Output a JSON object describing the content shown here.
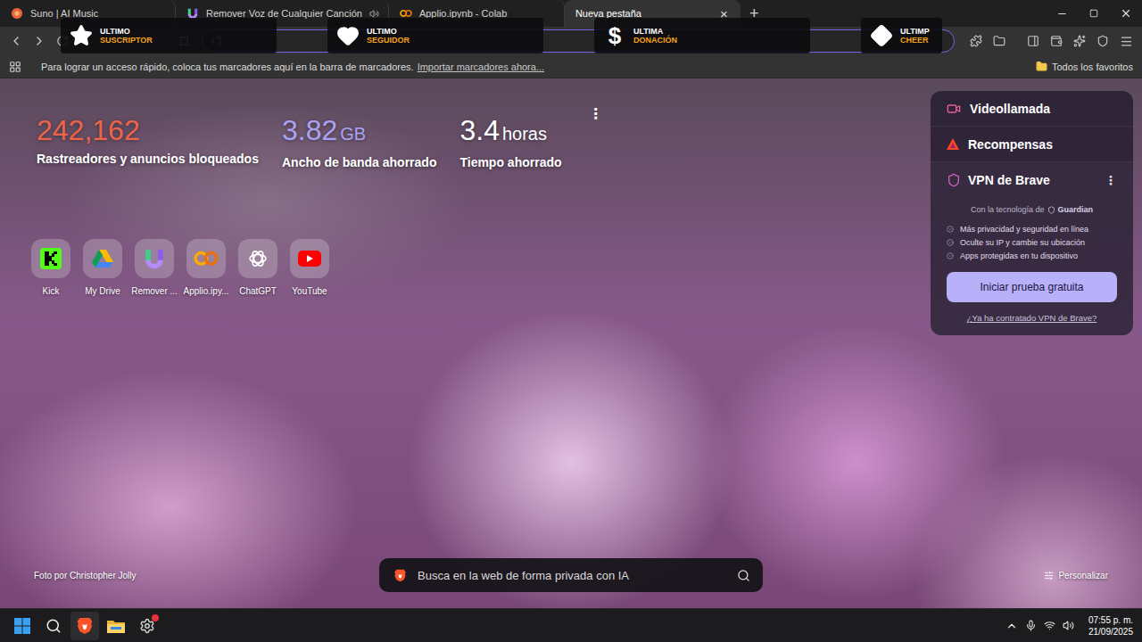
{
  "window": {
    "tab_close": "×",
    "new_tab": "+"
  },
  "tabs": [
    {
      "label": "Suno | AI Music",
      "selected": false,
      "audio": false
    },
    {
      "label": "Remover Voz de Cualquier Canción",
      "selected": false,
      "audio": true
    },
    {
      "label": "Applio.ipynb - Colab",
      "selected": false,
      "audio": false
    },
    {
      "label": "Nueva pestaña",
      "selected": true,
      "audio": false
    }
  ],
  "alerts": [
    {
      "kind": "star",
      "glyph": "",
      "title": "ULTIMO",
      "subtitle": "SUSCRIPTOR"
    },
    {
      "kind": "heart",
      "glyph": "",
      "title": "ULTIMO",
      "subtitle": "SEGUIDOR"
    },
    {
      "kind": "glyph",
      "glyph": "$",
      "title": "ULTIMA",
      "subtitle": "DONACIÓN"
    },
    {
      "kind": "diamond",
      "glyph": "",
      "title": "ULTIMP",
      "subtitle": "CHEER"
    }
  ],
  "address_bar": {
    "focused": true
  },
  "bookmarks_bar": {
    "message": "Para lograr un acceso rápido, coloca tus marcadores aquí en la barra de marcadores.",
    "link": "Importar marcadores ahora...",
    "all_favorites": "Todos los favoritos"
  },
  "stats": [
    {
      "value": "242,162",
      "unit": "",
      "label": "Rastreadores y anuncios bloqueados",
      "color": "#ee6446"
    },
    {
      "value": "3.82",
      "unit": "GB",
      "label": "Ancho de banda ahorrado",
      "color": "#aaa3f2"
    },
    {
      "value": "3.4",
      "unit": "horas",
      "label": "Tiempo ahorrado",
      "color": "#ffffff"
    }
  ],
  "stats_menu": "⋮",
  "shortcuts": [
    {
      "label": "Kick"
    },
    {
      "label": "My Drive"
    },
    {
      "label": "Remover ..."
    },
    {
      "label": "Applio.ipy..."
    },
    {
      "label": "ChatGPT"
    },
    {
      "label": "YouTube"
    }
  ],
  "side_panel": {
    "items": [
      {
        "label": "Videollamada"
      },
      {
        "label": "Recompensas"
      }
    ],
    "vpn": {
      "title": "VPN de Brave",
      "menu": "⋮",
      "powered_by": "Con la tecnología de",
      "partner": "Guardian",
      "features": [
        "Más privacidad y seguridad en línea",
        "Oculte su IP y cambie su ubicación",
        "Apps protegidas en tu dispositivo"
      ],
      "button": "Iniciar prueba gratuita",
      "link": "¿Ya ha contratado VPN de Brave?"
    }
  },
  "photo_credit": "Foto por Christopher Jolly",
  "search": {
    "placeholder": "Busca en la web de forma privada con IA"
  },
  "customize": "Personalizar",
  "taskbar": {
    "time": "07:55 p. m.",
    "date": "21/09/2025",
    "notification": true
  }
}
